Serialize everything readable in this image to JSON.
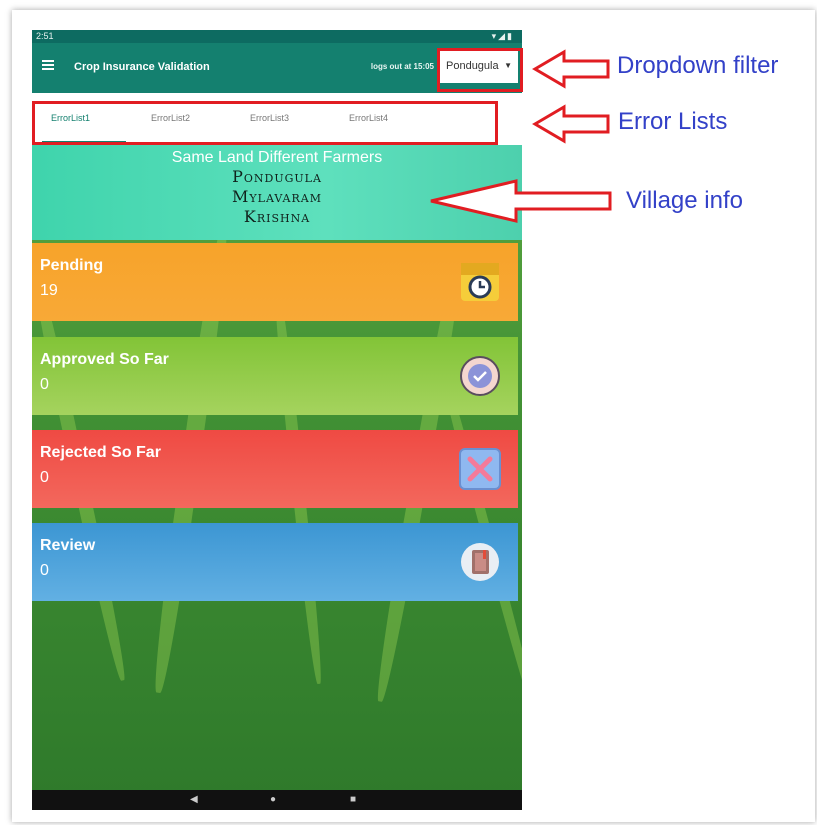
{
  "status_bar": {
    "time": "2:51"
  },
  "app_bar": {
    "title": "Crop Insurance Validation",
    "logout_text": "logs out at 15:05",
    "dropdown_value": "Pondugula"
  },
  "tabs": [
    {
      "label": "ErrorList1",
      "active": true
    },
    {
      "label": "ErrorList2",
      "active": false
    },
    {
      "label": "ErrorList3",
      "active": false
    },
    {
      "label": "ErrorList4",
      "active": false
    }
  ],
  "village": {
    "heading": "Same Land Different Farmers",
    "village_name": "Pondugula",
    "mandal": "Mylavaram",
    "district": "Krishna"
  },
  "cards": {
    "pending": {
      "label": "Pending",
      "count": "19",
      "icon": "clock-box-icon"
    },
    "approved": {
      "label": "Approved So Far",
      "count": "0",
      "icon": "check-circle-icon"
    },
    "rejected": {
      "label": "Rejected So Far",
      "count": "0",
      "icon": "x-square-icon"
    },
    "review": {
      "label": "Review",
      "count": "0",
      "icon": "book-icon"
    }
  },
  "nav": {
    "back": "◀",
    "home": "●",
    "recent": "■"
  },
  "annotations": {
    "dropdown": "Dropdown filter",
    "error_lists": "Error Lists",
    "village_info": "Village info"
  },
  "colors": {
    "app_bar": "#14806f",
    "pending": "#f7a32a",
    "approved": "#82c437",
    "rejected": "#ef4a43",
    "review": "#3c96d3",
    "annotation_box": "#e11d22",
    "annotation_text": "#3341c8"
  }
}
